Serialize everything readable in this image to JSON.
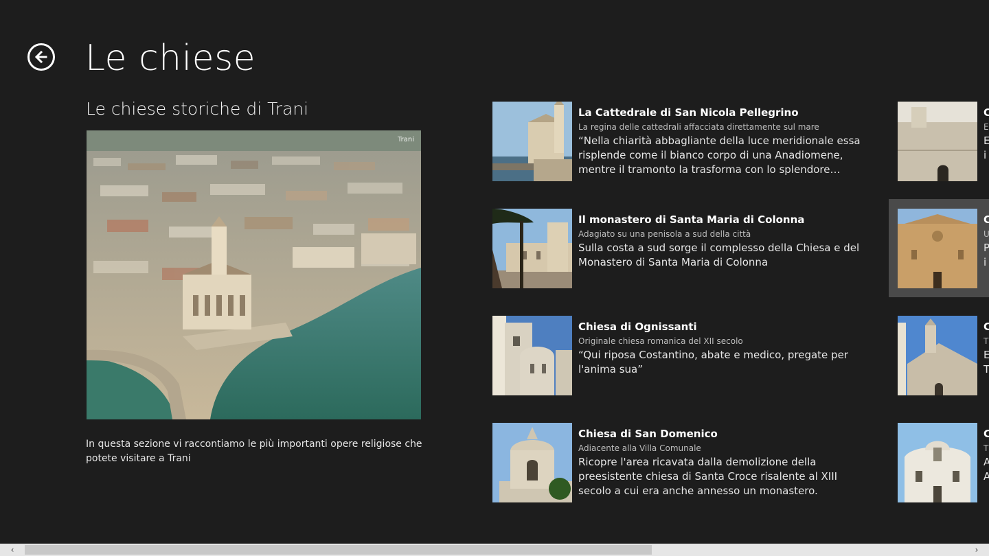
{
  "header": {
    "title": "Le chiese",
    "back_icon": "back-arrow-icon"
  },
  "intro": {
    "subtitle": "Le chiese storiche di Trani",
    "image_label": "Trani",
    "text": "In questa sezione vi raccontiamo le più importanti opere religiose che potete visitare a Trani"
  },
  "items": [
    {
      "title": "La Cattedrale di San Nicola Pellegrino",
      "subtitle": "La regina delle cattedrali affacciata direttamente sul mare",
      "description": "“Nella chiarità abbagliante della luce meridionale essa risplende come il bianco corpo di una Anadiomene, mentre il tramonto la trasforma con lo splendore…"
    },
    {
      "title": "Il monastero di Santa Maria di Colonna",
      "subtitle": "Adagiato su una penisola a sud della città",
      "description": "Sulla costa a sud sorge il complesso della Chiesa e del Monastero di Santa Maria di Colonna"
    },
    {
      "title": "Chiesa di Ognissanti",
      "subtitle": "Originale chiesa romanica del XII secolo",
      "description": "“Qui riposa Costantino, abate e medico, pregate per l'anima sua”"
    },
    {
      "title": "Chiesa di San Domenico",
      "subtitle": "Adiacente alla Villa Comunale",
      "description": "Ricopre l'area ricavata dalla demolizione della preesistente chiesa di Santa Croce risalente al XIII secolo a cui era anche annesso un monastero."
    }
  ],
  "items_col2": [
    {
      "title": "C",
      "subtitle": "E",
      "description": "E",
      "description2": "i"
    },
    {
      "title": "C",
      "subtitle": "U",
      "description": "P",
      "description2": "i"
    },
    {
      "title": "C",
      "subtitle": "T",
      "description": "E",
      "description2": "T"
    },
    {
      "title": "C",
      "subtitle": "T",
      "description": "A",
      "description2": "A"
    }
  ],
  "scrollbar": {
    "left_arrow": "‹",
    "right_arrow": "›",
    "position": 0.0
  },
  "colors": {
    "background": "#1d1d1d",
    "text": "#ffffff",
    "subtext": "#bdbdbd",
    "selected": "#4a4a4a"
  }
}
